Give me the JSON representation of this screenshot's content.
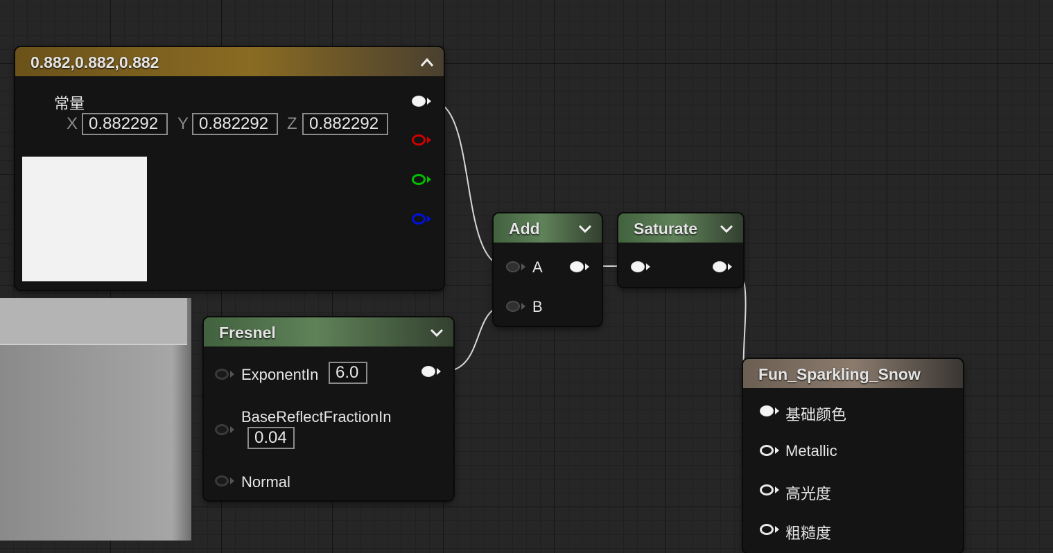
{
  "constant_node": {
    "title": "0.882,0.882,0.882",
    "label": "常量",
    "x_label": "X",
    "x_value": "0.882292",
    "y_label": "Y",
    "y_value": "0.882292",
    "z_label": "Z",
    "z_value": "0.882292",
    "swatch_color": "#f2f2f2",
    "collapse_icon": "chevron-up-icon"
  },
  "add_node": {
    "title": "Add",
    "input_a": "A",
    "input_b": "B",
    "expand_icon": "chevron-down-icon"
  },
  "saturate_node": {
    "title": "Saturate",
    "expand_icon": "chevron-down-icon"
  },
  "fresnel_node": {
    "title": "Fresnel",
    "exponent_label": "ExponentIn",
    "exponent_value": "6.0",
    "base_reflect_label": "BaseReflectFractionIn",
    "base_reflect_value": "0.04",
    "normal_label": "Normal",
    "expand_icon": "chevron-down-icon"
  },
  "material_node": {
    "title": "Fun_Sparkling_Snow",
    "inputs": [
      "基础颜色",
      "Metallic",
      "高光度",
      "粗糙度"
    ]
  },
  "colors": {
    "wire": "#d8d8d8",
    "red_channel": "#d00000",
    "green_channel": "#00c000",
    "blue_channel": "#0010e0"
  }
}
